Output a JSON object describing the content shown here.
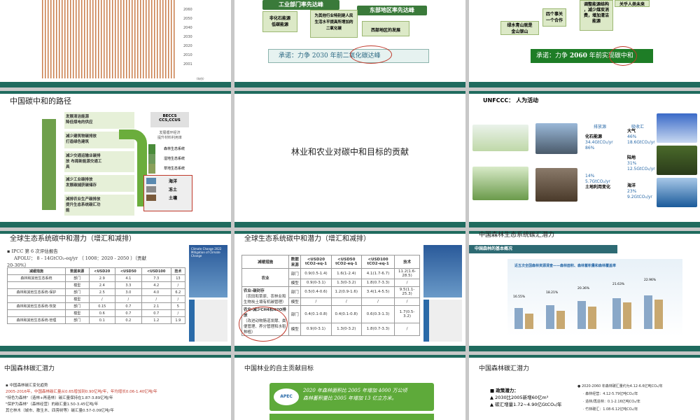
{
  "s1": {
    "years": [
      "2060",
      "2050",
      "2040",
      "2030",
      "2020",
      "2010",
      "2001"
    ],
    "unit": "（年份）"
  },
  "s2": {
    "h1": "工业部门率先达峰",
    "h2": "东部地区率先达峰",
    "a1": "非化石能源",
    "a2": "低碳能源",
    "b1": "为其他行业特别是人民",
    "b2": "生活水平提高所增加的",
    "b3": "二氧化碳",
    "c1": "西部地区的发展",
    "promise": "承诺：力争 2030 年前二氧化碳达峰"
  },
  "s3": {
    "r1": "四个事关",
    "r2": "一个合作",
    "r3": "绿水青山就是",
    "r4": "金山银山",
    "r5": "调整能源结构",
    "r6": "，减少煤炭消",
    "r7": "费，增加清洁",
    "r8": "能源",
    "r9": "关乎人类未来",
    "promise_pre": "承诺：力争 ",
    "promise_year": "2060",
    "promise_post": " 年前实现碳中和"
  },
  "s4": {
    "title": "中国碳中和的路径",
    "steps": [
      "发展清洁能源\n降低煤电的供应",
      "减少建筑物碳排放\n打造绿色建筑",
      "减少交通运输业碳排\n放 布局新能源交通工\n具",
      "减少工业碳排放\n发展碳捕获碳储存",
      "减排农业生产碳排放\n提升生态系统碳汇功\n能"
    ],
    "right_top1": "BECCS",
    "right_top2": "CCS,CCUS",
    "right_sub1": "发展循环经济",
    "right_sub2": "提升材料利用率",
    "eco": [
      "森林生态系统",
      "湿地生态系统",
      "草地生态系统"
    ],
    "eco2": [
      "海洋",
      "冻土",
      "土壤"
    ]
  },
  "s5": {
    "text": "林业和农业对碳中和目标的贡献"
  },
  "s6": {
    "title": "UNFCCC：",
    "subtitle": "人为活动",
    "emit": "排放源",
    "absorb": "吸收汇",
    "fossil": "化石能源",
    "fossil_v": "34.4GtCO₂/yr",
    "fossil_p": "86%",
    "land_p": "14%",
    "land_v": "5.7GtCO₂/yr",
    "land": "土地利用变化",
    "atm": "大气",
    "atm_p": "46%",
    "atm_v": "18.6GtCO₂/yr",
    "land2": "陆地",
    "land2_p": "31%",
    "land2_v": "12.5GtCO₂/yr",
    "ocean": "海洋",
    "ocean_p": "23%",
    "ocean_v": "9.2GtCO₂/yr"
  },
  "s7": {
    "title": "全球生态系统碳中和潜力（增汇和减排）",
    "b1": "IPCC 第 6 次评估报告",
    "b2": "AFOLU： 8 - 14GtCO₂-eq/yr （ 1008：2020 - 2050 ）（贡献",
    "b3": "20-30%）",
    "book1": "Climate Change 2022",
    "book2": "Mitigation of Climate Change"
  },
  "s8": {
    "title": "全球生态系统碳中和潜力（增汇和减排）",
    "headers": [
      "减缓措施",
      "数据来源",
      "<USD20 tCO2-eq-1",
      "<USD50 tCO2-eq-1",
      "<USD100 tCO2-eq-1",
      "技术"
    ],
    "rows": [
      [
        "农业",
        "部门",
        "0.9(0.5-1.4)",
        "1.6(1-2.4)",
        "4.1(1.7-6.7)",
        "11.2(1.6-28.5)"
      ],
      [
        "",
        "模型",
        "0.9(0-3.1)",
        "1.3(0-3.2)",
        "1.8(0.7-3.3)",
        "/"
      ],
      [
        "农业-碳封存",
        "部门",
        "0.5(0.4-0.6)",
        "1.2(0.9-1.6)",
        "3.4(1.4-5.5)",
        "9.5(1.1-25.3)"
      ],
      [
        "",
        "模型",
        "/",
        "/",
        "/",
        "/"
      ],
      [
        "农业-减少CH4和N2O排放",
        "部门",
        "0.4(0.1-0.8)",
        "0.4(0.1-0.8)",
        "0.6(0.3-1.3)",
        "1.7(0.5-3.2)"
      ],
      [
        "",
        "模型",
        "0.9(0-3.1)",
        "1.3(0-3.2)",
        "1.8(0.7-3.3)",
        "/"
      ]
    ],
    "sub1": "（农田和草原、农林业和生物炭土壤有机碳管理）",
    "sub2": "（改进动物肠道发酵、粪便管理、养分管理和水稻种植）"
  },
  "s9": {
    "title": "中国森林生态系统碳汇潜力",
    "banner": "中国森林的基本概况",
    "chart_title": "近五次全国森林资源清查——森林面积、森林蓄积量和森林覆盖率",
    "p1": "16.55%",
    "p2": "18.21%",
    "p3": "20.36%",
    "p4": "21.63%",
    "p5": "22.96%"
  },
  "s10": {
    "title": "中国森林碳汇潜力",
    "b1": "中国森林碳汇变化趋势",
    "b2": "2005-2016年，中国森林碳汇量从0.65增加到0.90亿吨/年，年均增长0.06-1.40亿吨/年",
    "b3": "\"特色为森林\"（造林+再造林）碳汇量保持在1.87-3.89亿吨/年",
    "b4": "\"保护为森林\"（森林经营）的碳汇量1.50-3.45亿吨/年",
    "b5": "其它林木（城市、散生木、四旁树等）碳汇量0.57-0.09亿吨/年"
  },
  "s11": {
    "title": "中国林业的自主贡献目标",
    "badge": "APEC",
    "line1": "2020 年森林面积比 2005 年增加 4000 万公顷",
    "line2": "森林蓄积量比 2005 年增加 13 亿立方米。"
  },
  "s12": {
    "title": "中国森林碳汇潜力",
    "policy": "政策潜力：",
    "i1": "2030比2005新增60亿m³",
    "i2": "碳汇增量1.72~4.90亿GtCO₂/年",
    "r1": "2020-2060 年森林碳汇量约为4.12-6.6亿吨CO₂/年",
    "r2": "森林经营：4.12-5.79亿吨CO₂/年",
    "r3": "造林/再造林：0.1-2.16亿吨CO₂/年",
    "r4": "竹林碳汇：1.08-6.12亿吨CO₂/年"
  },
  "colors": {
    "teal": "#1f6b5e",
    "green": "#6bad3c",
    "red": "#c0392b"
  }
}
